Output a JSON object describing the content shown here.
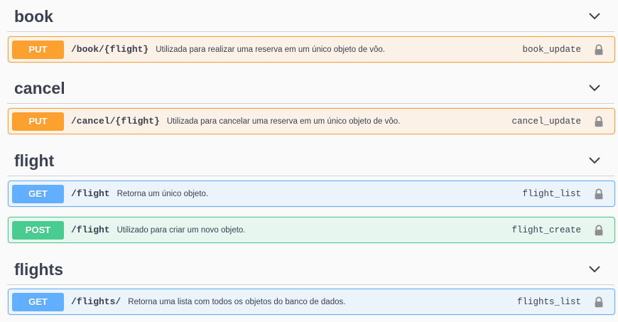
{
  "sections": [
    {
      "title": "book",
      "operations": [
        {
          "method": "PUT",
          "path": "/book/{flight}",
          "summary": "Utilizada para realizar uma reserva em um único objeto de vôo.",
          "operation_id": "book_update"
        }
      ]
    },
    {
      "title": "cancel",
      "operations": [
        {
          "method": "PUT",
          "path": "/cancel/{flight}",
          "summary": "Utilizada para cancelar uma reserva em um único objeto de vôo.",
          "operation_id": "cancel_update"
        }
      ]
    },
    {
      "title": "flight",
      "operations": [
        {
          "method": "GET",
          "path": "/flight",
          "summary": "Retorna um único objeto.",
          "operation_id": "flight_list"
        },
        {
          "method": "POST",
          "path": "/flight",
          "summary": "Utilizado para criar um novo objeto.",
          "operation_id": "flight_create"
        }
      ]
    },
    {
      "title": "flights",
      "operations": [
        {
          "method": "GET",
          "path": "/flights/",
          "summary": "Retorna uma lista com todos os objetos do banco de dados.",
          "operation_id": "flights_list"
        }
      ]
    }
  ],
  "icons": {
    "expand": "chevron-down-icon",
    "auth": "lock-icon"
  },
  "colors": {
    "put": "#fca130",
    "get": "#61affe",
    "post": "#49cc90",
    "text": "#3b4151"
  }
}
